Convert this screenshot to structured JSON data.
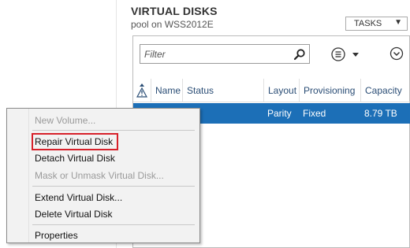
{
  "section": {
    "title": "VIRTUAL DISKS",
    "subtitle": "pool on WSS2012E",
    "tasks_label": "TASKS",
    "tasks_arrow": "▼"
  },
  "filter": {
    "placeholder": "Filter"
  },
  "table": {
    "columns": [
      "Name",
      "Status",
      "Layout",
      "Provisioning",
      "Capacity"
    ],
    "selected_row": {
      "layout": "Parity",
      "provisioning": "Fixed",
      "capacity": "8.79 TB"
    }
  },
  "context_menu": {
    "items": [
      {
        "label": "New Volume...",
        "enabled": false
      },
      {
        "label": "Repair Virtual Disk",
        "enabled": true,
        "highlighted": true
      },
      {
        "label": "Detach Virtual Disk",
        "enabled": true
      },
      {
        "label": "Mask or Unmask Virtual Disk...",
        "enabled": false
      },
      {
        "label": "Extend Virtual Disk...",
        "enabled": true
      },
      {
        "label": "Delete Virtual Disk",
        "enabled": true
      },
      {
        "label": "Properties",
        "enabled": true
      }
    ]
  },
  "colors": {
    "selection": "#1c6fb7",
    "highlight_border": "#d7202a",
    "header_text": "#2a4d75"
  }
}
